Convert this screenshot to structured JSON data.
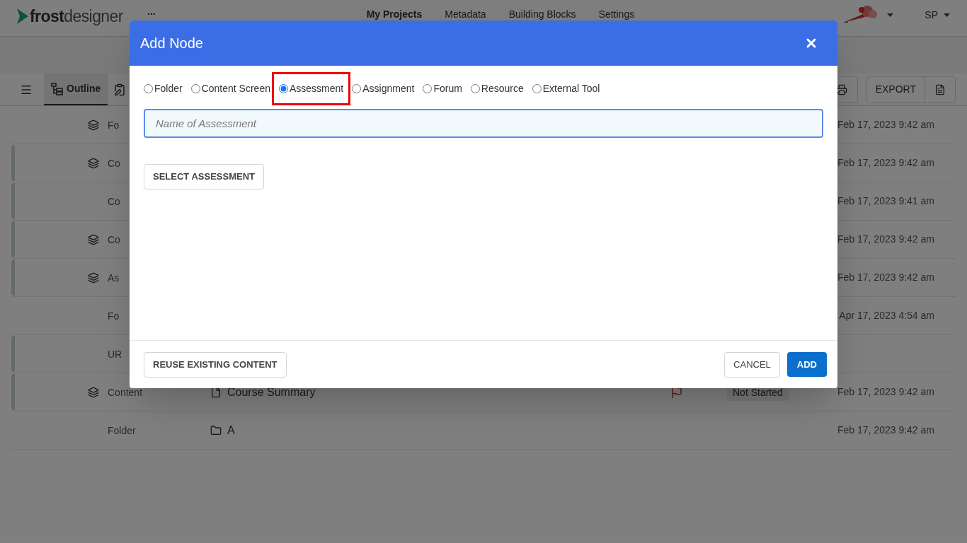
{
  "header": {
    "logo": {
      "bold": "frost",
      "light": "designer"
    },
    "more": "...",
    "nav": [
      {
        "label": "My Projects",
        "selected": true
      },
      {
        "label": "Metadata",
        "selected": false
      },
      {
        "label": "Building Blocks",
        "selected": false
      },
      {
        "label": "Settings",
        "selected": false
      }
    ],
    "user": "SP"
  },
  "toolbar": {
    "tabs": [
      {
        "label": "Outline",
        "selected": true
      }
    ],
    "export": "EXPORT"
  },
  "rows": [
    {
      "type": "Fo",
      "layered": true,
      "accent": false,
      "date": "Feb 17, 2023 9:42 am"
    },
    {
      "type": "Co",
      "layered": true,
      "accent": true,
      "date": "Feb 17, 2023 9:42 am"
    },
    {
      "type": "Co",
      "layered": false,
      "accent": true,
      "date": "Feb 17, 2023 9:41 am"
    },
    {
      "type": "Co",
      "layered": true,
      "accent": true,
      "date": "Feb 17, 2023 9:42 am"
    },
    {
      "type": "As",
      "layered": true,
      "accent": true,
      "date": "Feb 17, 2023 9:42 am"
    },
    {
      "type": "Fo",
      "layered": false,
      "accent": false,
      "date": "Apr 17, 2023 4:54 am"
    },
    {
      "type": "UR",
      "layered": false,
      "accent": true
    },
    {
      "type": "Content",
      "layered": true,
      "accent": true,
      "name": {
        "text": "Course Summary",
        "kind": "page"
      },
      "flagged": true,
      "status": "Not Started",
      "date": "Feb 17, 2023 9:42 am"
    },
    {
      "type": "Folder",
      "layered": false,
      "accent": false,
      "name": {
        "text": "A",
        "kind": "folder"
      },
      "date": "Feb 17, 2023 9:42 am"
    }
  ],
  "dialog": {
    "title": "Add Node",
    "options": [
      {
        "label": "Folder",
        "selected": false,
        "highlighted": false
      },
      {
        "label": "Content Screen",
        "selected": false,
        "highlighted": false
      },
      {
        "label": "Assessment",
        "selected": true,
        "highlighted": true
      },
      {
        "label": "Assignment",
        "selected": false,
        "highlighted": false
      },
      {
        "label": "Forum",
        "selected": false,
        "highlighted": false
      },
      {
        "label": "Resource",
        "selected": false,
        "highlighted": false
      },
      {
        "label": "External Tool",
        "selected": false,
        "highlighted": false
      }
    ],
    "name_field": {
      "placeholder": "Name of Assessment"
    },
    "select_button": "SELECT ASSESSMENT",
    "reuse_button": "REUSE EXISTING CONTENT",
    "cancel_button": "CANCEL",
    "add_button": "ADD"
  }
}
